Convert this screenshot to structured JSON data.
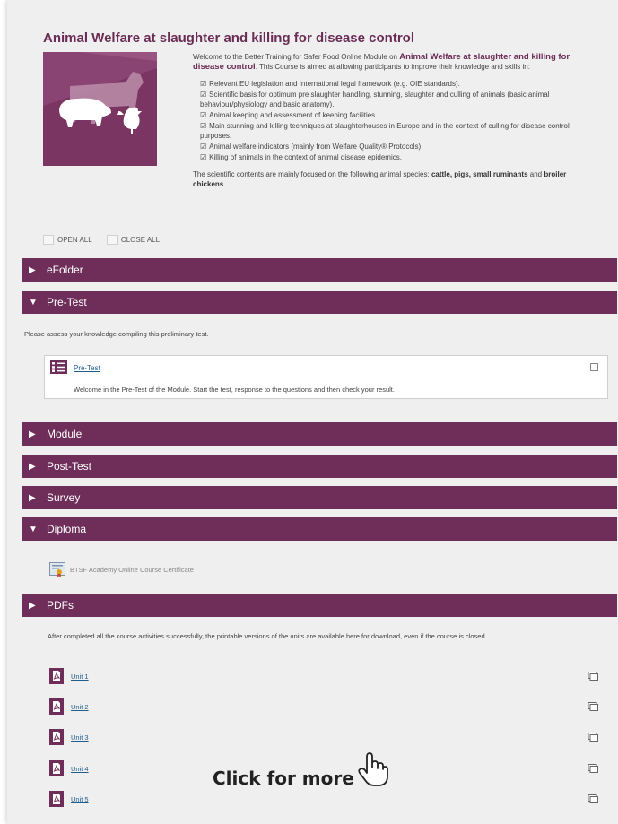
{
  "course": {
    "title": "Animal Welfare at slaughter and killing for disease control",
    "intro_prefix": "Welcome to the Better Training for Safer Food Online Module on",
    "intro_bold": "Animal Welfare at slaughter and killing for disease control",
    "intro_suffix": ". This Course is aimed at allowing participants to improve their knowledge and skills in:",
    "topics": [
      "Relevant EU legislation and International legal framework (e.g. OIE standards).",
      "Scientific basis for optimum pre slaughter handling, stunning, slaughter and culling of animals (basic animal behaviour/physiology and basic anatomy).",
      "Animal keeping and assessment of keeping facilities.",
      "Main stunning and killing techniques at slaughterhouses in Europe and in the context of culling for disease control purposes.",
      "Animal welfare indicators (mainly from Welfare Quality® Protocols).",
      "Killing of animals in the context of animal disease epidemics."
    ],
    "species_prefix": "The scientific contents are mainly focused on the following animal species:",
    "species_bold_1": "cattle, pigs, small ruminants",
    "species_and": "and",
    "species_bold_2": "broiler chickens",
    "species_end": "."
  },
  "toggles": {
    "open_all": "OPEN ALL",
    "close_all": "CLOSE ALL"
  },
  "sections": {
    "efolder": "eFolder",
    "pretest": "Pre-Test",
    "module": "Module",
    "posttest": "Post-Test",
    "survey": "Survey",
    "diploma": "Diploma",
    "pdfs": "PDFs"
  },
  "pretest": {
    "hint": "Please assess your knowledge compiling this preliminary test.",
    "link": "Pre-Test",
    "description": "Welcome in the Pre-Test of the Module. Start the test, response to the questions and then check your result."
  },
  "diploma": {
    "certificate": "BTSF Academy Online Course Certificate"
  },
  "pdfs": {
    "hint": "After completed all the course activities successfully, the printable versions of the units are available here for download, even if the course is closed.",
    "units": [
      "Unit 1",
      "Unit 2",
      "Unit 3",
      "Unit 4",
      "Unit 5"
    ]
  },
  "cta": {
    "label": "Click for more"
  },
  "colors": {
    "accent": "#6e2e59",
    "title": "#6a2c55",
    "link": "#1f5e8a",
    "background": "#efefef"
  }
}
